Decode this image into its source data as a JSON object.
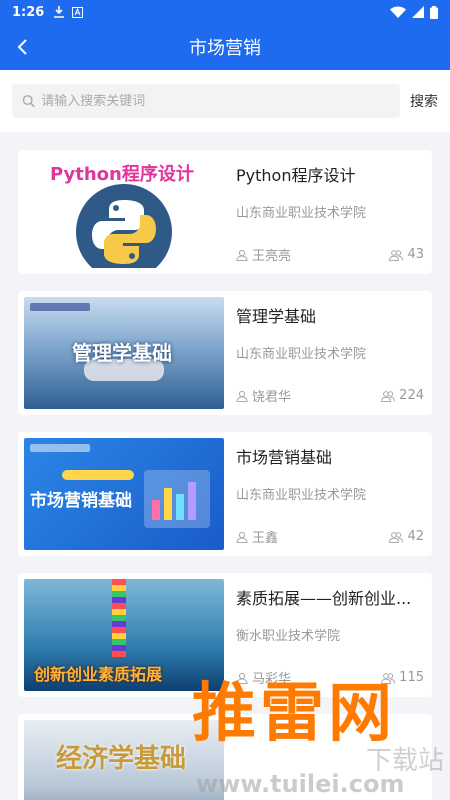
{
  "status": {
    "time": "1:26"
  },
  "header": {
    "title": "市场营销"
  },
  "search": {
    "placeholder": "请输入搜索关键词",
    "button": "搜索"
  },
  "courses": [
    {
      "title": "Python程序设计",
      "school": "山东商业职业技术学院",
      "teacher": "王亮亮",
      "count": "43",
      "thumb_text": "Python程序设计"
    },
    {
      "title": "管理学基础",
      "school": "山东商业职业技术学院",
      "teacher": "饶君华",
      "count": "224",
      "thumb_text": "管理学基础"
    },
    {
      "title": "市场营销基础",
      "school": "山东商业职业技术学院",
      "teacher": "王鑫",
      "count": "42",
      "thumb_text": "市场营销基础"
    },
    {
      "title": "素质拓展——创新创业...",
      "school": "衡水职业技术学院",
      "teacher": "马彩华",
      "count": "115",
      "thumb_text": "创新创业素质拓展"
    },
    {
      "title": "",
      "school": "",
      "teacher": "",
      "count": "",
      "thumb_text": "经济学基础"
    }
  ],
  "watermark": {
    "text": "推雷网",
    "url": "www.tuilei.com",
    "tag": "下载站"
  },
  "colors": {
    "primary": "#1f6bf0",
    "background": "#f3f4f7",
    "watermark": "#ff7a00"
  }
}
